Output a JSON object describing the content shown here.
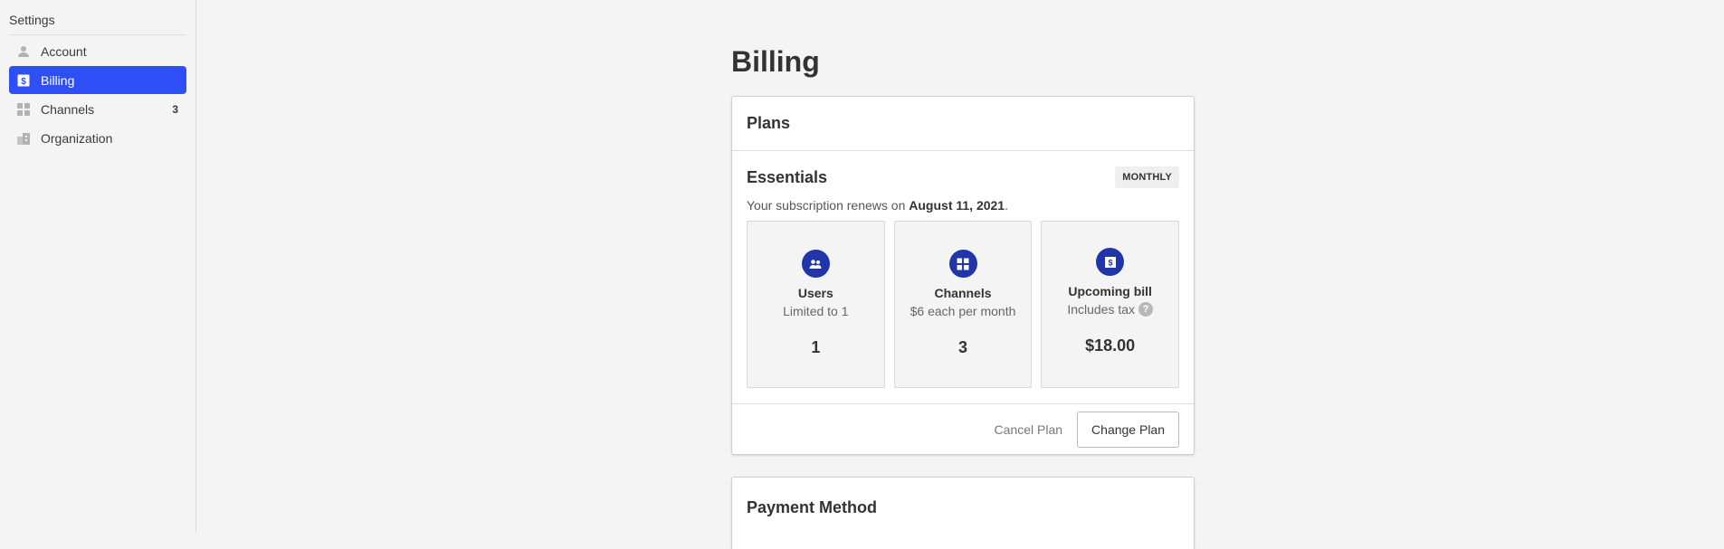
{
  "sidebar": {
    "title": "Settings",
    "items": [
      {
        "label": "Account",
        "icon": "person-icon",
        "count": "",
        "active": false
      },
      {
        "label": "Billing",
        "icon": "dollar-bill-icon",
        "count": "",
        "active": true
      },
      {
        "label": "Channels",
        "icon": "grid-icon",
        "count": "3",
        "active": false
      },
      {
        "label": "Organization",
        "icon": "building-icon",
        "count": "",
        "active": false
      }
    ]
  },
  "page": {
    "title": "Billing"
  },
  "plans": {
    "heading": "Plans",
    "plan_name": "Essentials",
    "cycle_badge": "MONTHLY",
    "renew_prefix": "Your subscription renews on ",
    "renew_date": "August 11, 2021",
    "renew_suffix": ".",
    "tiles": [
      {
        "title": "Users",
        "subtitle": "Limited to 1",
        "value": "1",
        "icon": "users-icon"
      },
      {
        "title": "Channels",
        "subtitle": "$6 each per month",
        "value": "3",
        "icon": "grid-icon"
      },
      {
        "title": "Upcoming bill",
        "subtitle": "Includes tax",
        "value": "$18.00",
        "icon": "dollar-bill-icon",
        "help_icon": "?"
      }
    ],
    "cancel_label": "Cancel Plan",
    "change_label": "Change Plan"
  },
  "payment": {
    "heading": "Payment Method"
  },
  "colors": {
    "accent": "#2d4ff5",
    "icon_circle": "#1f35a8",
    "background": "#f4f4f4"
  }
}
